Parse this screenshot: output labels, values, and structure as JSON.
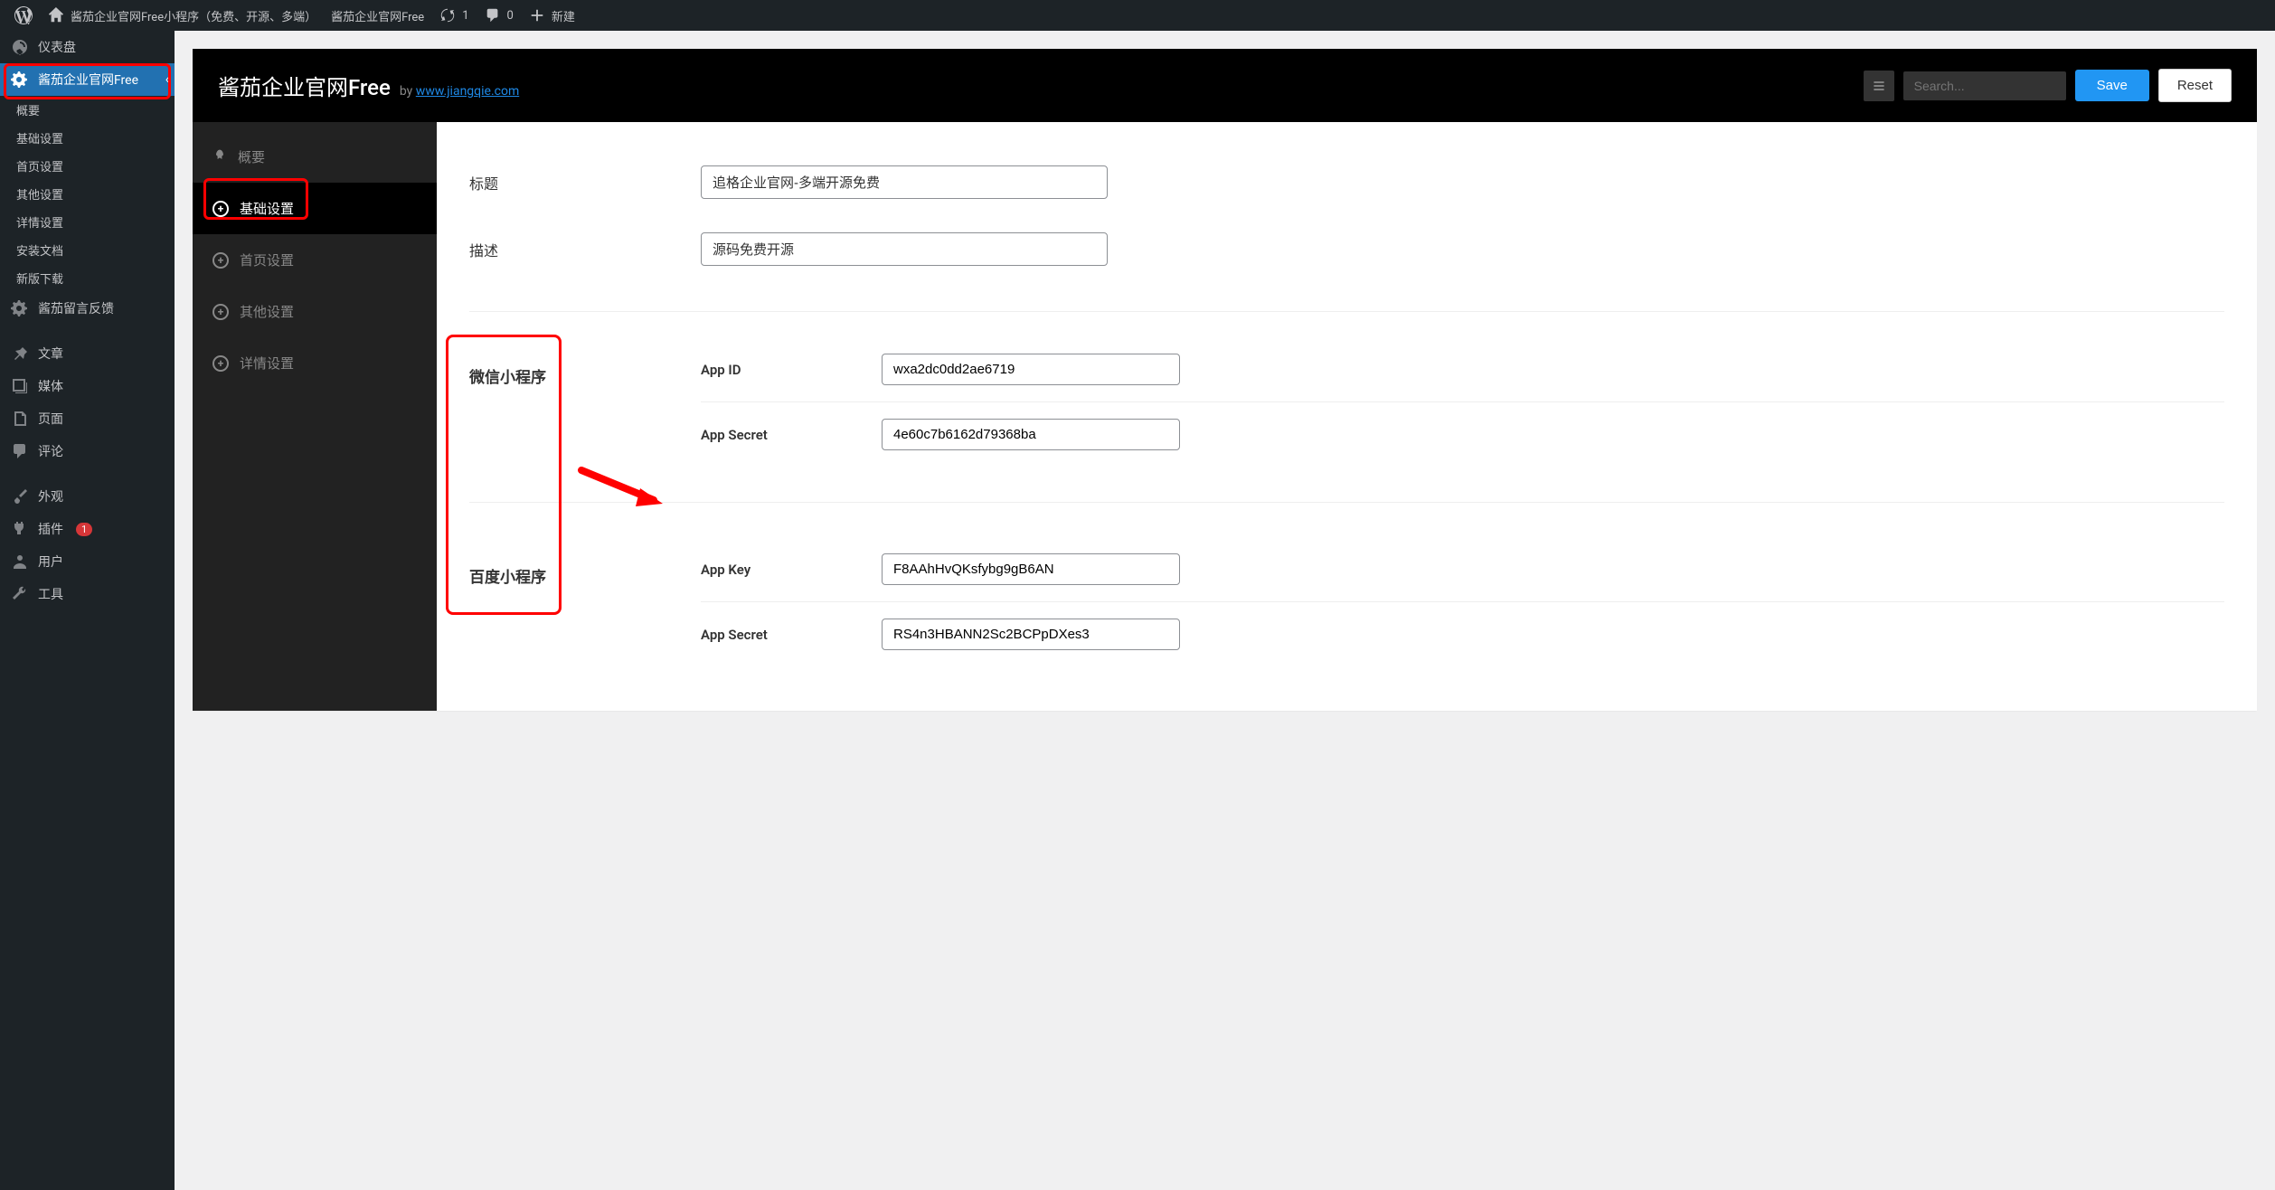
{
  "admin_bar": {
    "wp_logo": "W",
    "site_name": "酱茄企业官网Free小程序（免费、开源、多端）",
    "plugin_name": "酱茄企业官网Free",
    "updates_count": "1",
    "comments_count": "0",
    "new_label": "新建"
  },
  "wp_sidebar": {
    "dashboard": "仪表盘",
    "plugin_main": "酱茄企业官网Free",
    "submenu": {
      "overview": "概要",
      "basic": "基础设置",
      "home": "首页设置",
      "other": "其他设置",
      "detail": "详情设置",
      "install": "安装文档",
      "version": "新版下载"
    },
    "feedback": "酱茄留言反馈",
    "posts": "文章",
    "media": "媒体",
    "pages": "页面",
    "comments": "评论",
    "appearance": "外观",
    "plugins": "插件",
    "plugins_badge": "1",
    "users": "用户",
    "tools": "工具"
  },
  "panel": {
    "title": "酱茄企业官网Free",
    "by": "by",
    "link": "www.jiangqie.com",
    "search_placeholder": "Search...",
    "save": "Save",
    "reset": "Reset"
  },
  "panel_nav": {
    "overview": "概要",
    "basic": "基础设置",
    "home": "首页设置",
    "other": "其他设置",
    "detail": "详情设置"
  },
  "form": {
    "title_label": "标题",
    "title_value": "追格企业官网-多端开源免费",
    "desc_label": "描述",
    "desc_value": "源码免费开源",
    "wechat_section": "微信小程序",
    "baidu_section": "百度小程序",
    "app_id_label": "App ID",
    "app_id_value": "wxa2dc0dd2ae6719",
    "app_secret_label": "App Secret",
    "app_secret_value": "4e60c7b6162d79368ba",
    "app_key_label": "App Key",
    "app_key_value": "F8AAhHvQKsfybg9gB6AN",
    "baidu_secret_label": "App Secret",
    "baidu_secret_value": "RS4n3HBANN2Sc2BCPpDXes3"
  }
}
